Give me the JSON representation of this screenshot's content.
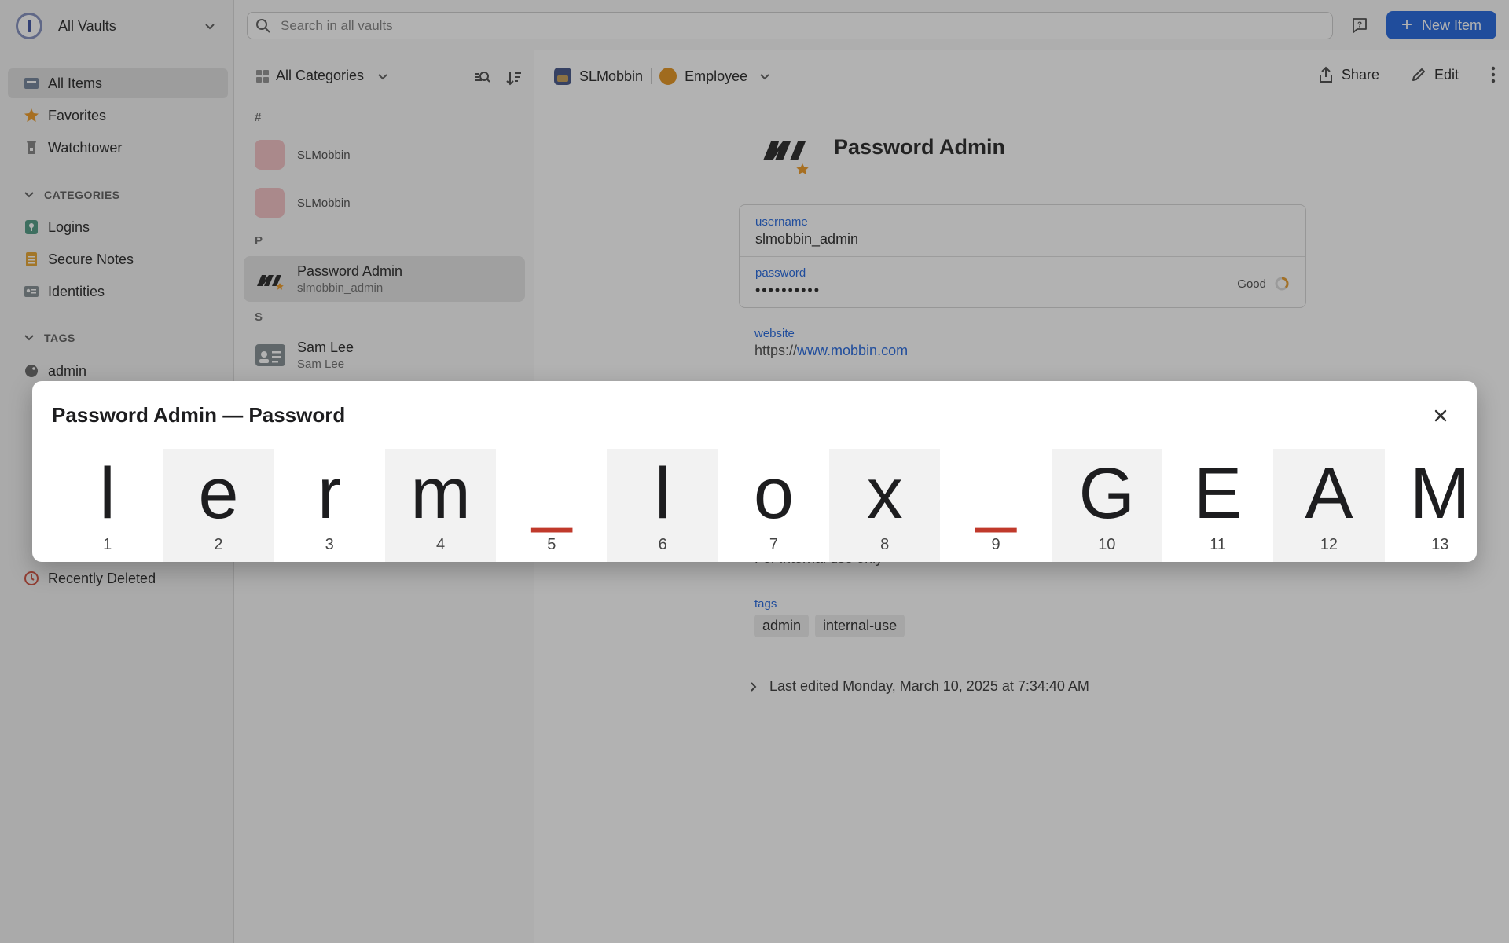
{
  "sidebar": {
    "vault_name": "All Vaults",
    "nav": [
      {
        "label": "All Items",
        "icon": "all-items-icon"
      },
      {
        "label": "Favorites",
        "icon": "star-icon"
      },
      {
        "label": "Watchtower",
        "icon": "watchtower-icon"
      }
    ],
    "categories_heading": "CATEGORIES",
    "categories": [
      {
        "label": "Logins",
        "icon": "login-icon"
      },
      {
        "label": "Secure Notes",
        "icon": "note-icon"
      },
      {
        "label": "Identities",
        "icon": "identity-icon"
      }
    ],
    "tags_heading": "TAGS",
    "tags": [
      {
        "label": "admin",
        "icon": "tag-icon"
      }
    ],
    "recently_deleted": "Recently Deleted"
  },
  "topbar": {
    "search_placeholder": "Search in all vaults",
    "new_item_label": "New Item"
  },
  "list": {
    "filter_label": "All Categories",
    "groups": [
      {
        "letter": "#",
        "items": [
          {
            "title": "SLMobbin",
            "subtitle": "",
            "thumb": "pink-placeholder"
          },
          {
            "title": "SLMobbin",
            "subtitle": "",
            "thumb": "pink-placeholder"
          }
        ]
      },
      {
        "letter": "P",
        "items": [
          {
            "title": "Password Admin",
            "subtitle": "slmobbin_admin",
            "thumb": "mobbin-logo",
            "selected": true
          }
        ]
      },
      {
        "letter": "S",
        "items": [
          {
            "title": "Sam Lee",
            "subtitle": "Sam Lee",
            "thumb": "id-card-icon"
          }
        ]
      }
    ]
  },
  "detail": {
    "vault": "SLMobbin",
    "category": "Employee",
    "share_label": "Share",
    "edit_label": "Edit",
    "title": "Password Admin",
    "username_label": "username",
    "username_value": "slmobbin_admin",
    "password_label": "password",
    "password_masked": "••••••••••",
    "password_strength": "Good",
    "website_label": "website",
    "website_prefix": "https://",
    "website_domain": "www.mobbin.com",
    "notes_partial": "For internal use only",
    "tags_label": "tags",
    "tags": [
      "admin",
      "internal-use"
    ],
    "last_edited": "Last edited Monday, March 10, 2025 at 7:34:40 AM"
  },
  "modal": {
    "title": "Password Admin — Password",
    "chars": [
      {
        "ch": "l",
        "n": "1",
        "symbol": false
      },
      {
        "ch": "e",
        "n": "2",
        "symbol": false
      },
      {
        "ch": "r",
        "n": "3",
        "symbol": false
      },
      {
        "ch": "m",
        "n": "4",
        "symbol": false
      },
      {
        "ch": "_",
        "n": "5",
        "symbol": true
      },
      {
        "ch": "l",
        "n": "6",
        "symbol": false
      },
      {
        "ch": "o",
        "n": "7",
        "symbol": false
      },
      {
        "ch": "x",
        "n": "8",
        "symbol": false
      },
      {
        "ch": "_",
        "n": "9",
        "symbol": true
      },
      {
        "ch": "G",
        "n": "10",
        "symbol": false
      },
      {
        "ch": "E",
        "n": "11",
        "symbol": false
      },
      {
        "ch": "A",
        "n": "12",
        "symbol": false
      },
      {
        "ch": "M",
        "n": "13",
        "symbol": false
      }
    ]
  },
  "colors": {
    "accent": "#2f6fe0",
    "symbol_char": "#c0392b",
    "overlay": "rgba(0,0,0,0.30)"
  }
}
